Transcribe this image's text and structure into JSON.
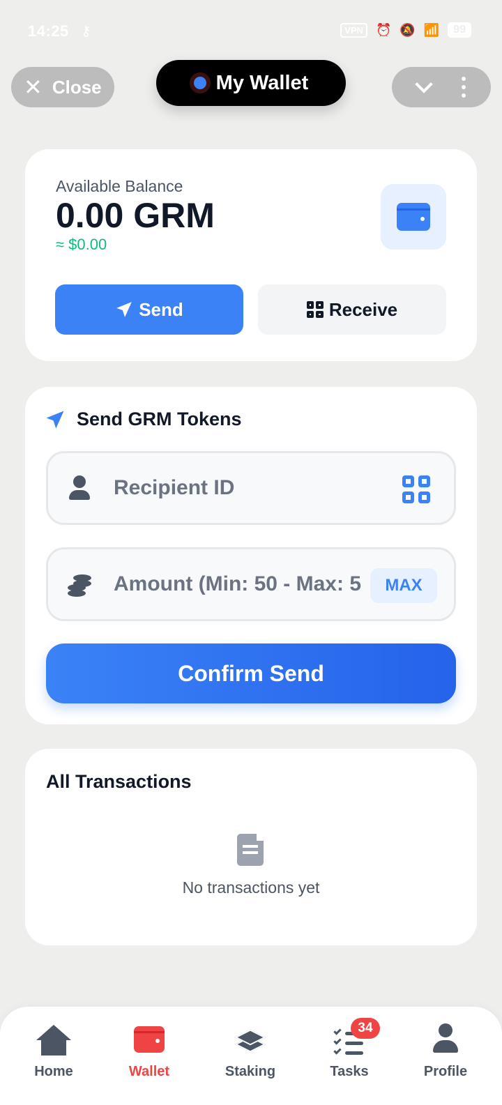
{
  "status_bar": {
    "time": "14:25",
    "vpn": "VPN",
    "battery": "99"
  },
  "header": {
    "close_label": "Close",
    "title": "My Wallet",
    "accent_color": "#3b82f6"
  },
  "balance": {
    "label": "Available Balance",
    "value": "0.00 GRM",
    "fiat": "≈ $0.00",
    "send_label": "Send",
    "receive_label": "Receive"
  },
  "send_form": {
    "title": "Send GRM Tokens",
    "recipient_placeholder": "Recipient ID",
    "amount_placeholder": "Amount (Min: 50 - Max: 5",
    "max_label": "MAX",
    "confirm_label": "Confirm Send"
  },
  "transactions": {
    "title": "All Transactions",
    "empty_text": "No transactions yet"
  },
  "bottom_nav": {
    "items": [
      {
        "label": "Home",
        "icon": "home-icon"
      },
      {
        "label": "Wallet",
        "icon": "wallet-icon",
        "active": true
      },
      {
        "label": "Staking",
        "icon": "layers-icon"
      },
      {
        "label": "Tasks",
        "icon": "tasks-icon",
        "badge": "34"
      },
      {
        "label": "Profile",
        "icon": "user-icon"
      }
    ],
    "active_color": "#ef4444"
  }
}
